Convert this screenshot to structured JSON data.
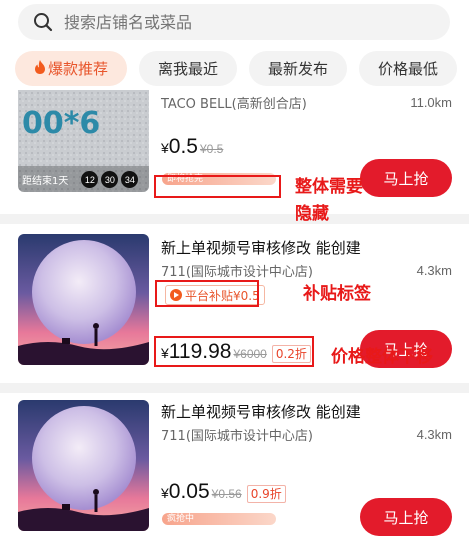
{
  "search": {
    "placeholder": "搜索店铺名或菜品"
  },
  "tabs": [
    {
      "label": "爆款推荐",
      "active": true
    },
    {
      "label": "离我最近"
    },
    {
      "label": "最新发布"
    },
    {
      "label": "价格最低"
    }
  ],
  "items": [
    {
      "title": "",
      "shop": "TACO BELL(高新创合店)",
      "distance": "11.0km",
      "price": {
        "currency": "¥",
        "amount": "0.5",
        "original": "¥0.5"
      },
      "status": "即将抢完",
      "status_progress": 1.0,
      "countdown": {
        "label": "距结束1天",
        "hours": "12",
        "minutes": "30",
        "seconds": "34"
      },
      "buy_label": "马上抢"
    },
    {
      "title": "新上单视频号审核修改 能创建",
      "shop": "711(国际城市设计中心店)",
      "distance": "4.3km",
      "subsidy": "平台补贴¥0.5",
      "price": {
        "currency": "¥",
        "amount": "119.98",
        "original": "¥6000",
        "discount": "0.2折"
      },
      "buy_label": "马上抢"
    },
    {
      "title": "新上单视频号审核修改 能创建",
      "shop": "711(国际城市设计中心店)",
      "distance": "4.3km",
      "price": {
        "currency": "¥",
        "amount": "0.05",
        "original": "¥0.56",
        "discount": "0.9折"
      },
      "status": "疯抢中",
      "status_progress": 1.0,
      "buy_label": "马上抢"
    }
  ],
  "annotations": {
    "hide": "整体需要\n隐藏",
    "subsidy_tag": "补贴标签",
    "price_move": "价格整体下移"
  },
  "colors": {
    "accent": "#e31b2b",
    "annotation": "#e81919",
    "tab_active_bg": "#fde8de"
  }
}
